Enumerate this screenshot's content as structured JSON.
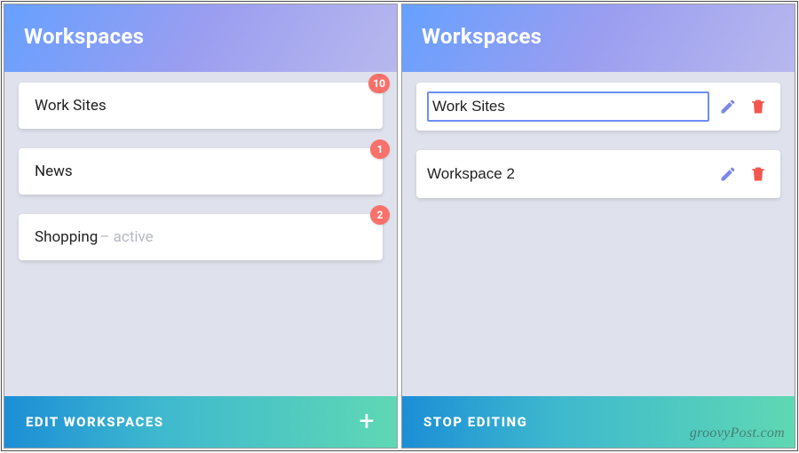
{
  "left": {
    "header_title": "Workspaces",
    "items": [
      {
        "name": "Work Sites",
        "badge": "10",
        "active": false
      },
      {
        "name": "News",
        "badge": "1",
        "active": false
      },
      {
        "name": "Shopping",
        "badge": "2",
        "active": true,
        "active_label": " – active"
      }
    ],
    "footer_label": "EDIT WORKSPACES",
    "footer_plus": "+"
  },
  "right": {
    "header_title": "Workspaces",
    "items": [
      {
        "name": "Work Sites",
        "selected": true
      },
      {
        "name": "Workspace 2",
        "selected": false
      }
    ],
    "footer_label": "STOP EDITING"
  },
  "icons": {
    "pencil_color_blue": "#7b87e8",
    "trash_color_red": "#f2564e",
    "badge_color": "#f9716a"
  },
  "watermark": "groovyPost.com"
}
